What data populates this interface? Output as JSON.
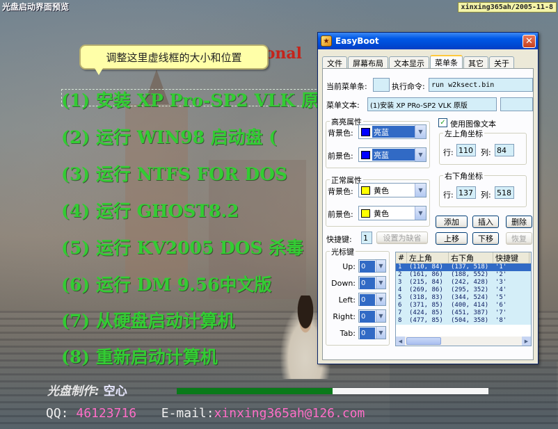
{
  "preview": {
    "title": "光盘启动界面预览",
    "author_stamp": "xinxing365ah/2005-11-8",
    "hint": "调整这里虚线框的大小和位置",
    "banner_fragment": "sional",
    "menu_items": [
      "(1) 安装 XP Pro-SP2 VLK 原",
      "(2) 运行 WIN98 启动盘 (",
      "(3) 运行 NTFS FOR DOS",
      "(4) 运行 GHOST8.2",
      "(5) 运行 KV2005 DOS 杀毒",
      "(6) 运行 DM 9.56中文版",
      "(7) 从硬盘启动计算机",
      "(8) 重新启动计算机"
    ],
    "credits_label": "光盘制作:",
    "credits_name": "空心",
    "progress_fraction": 0.5,
    "qq_label": "QQ:",
    "qq_value": "46123716",
    "email_label": "E-mail:",
    "email_value": "xinxing365ah@126.com"
  },
  "dialog": {
    "title": "EasyBoot",
    "tabs": [
      "文件",
      "屏幕布局",
      "文本显示",
      "菜单条",
      "其它",
      "关于"
    ],
    "active_tab": "菜单条",
    "current_menu_label": "当前菜单条:",
    "current_menu_value": "",
    "exec_label": "执行命令:",
    "exec_value": "run w2ksect.bin",
    "menu_text_label": "菜单文本:",
    "menu_text_value": "(1)安装 XP PRo-SP2 VLK 原版",
    "highlight_group": "高亮属性",
    "bg_color_label": "背景色:",
    "fg_color_label": "前景色:",
    "highlight_bg": {
      "name": "亮蓝",
      "color": "#0000ff"
    },
    "highlight_fg": {
      "name": "亮蓝",
      "color": "#0000ff"
    },
    "normal_group": "正常属性",
    "normal_bg": {
      "name": "黄色",
      "color": "#ffff00"
    },
    "normal_fg": {
      "name": "黄色",
      "color": "#ffff00"
    },
    "use_image_text": "使用图像文本",
    "use_image_checked": true,
    "top_left_group": "左上角坐标",
    "bottom_right_group": "右下角坐标",
    "row_label": "行:",
    "col_label": "列:",
    "top_left_row": "110",
    "top_left_col": "84",
    "bottom_right_row": "137",
    "bottom_right_col": "518",
    "buttons": {
      "add": "添加",
      "insert": "插入",
      "delete": "删除",
      "up": "上移",
      "down": "下移",
      "restore": "恢复"
    },
    "hotkey_label": "快捷键:",
    "hotkey_value": "1",
    "set_default": "设置为缺省",
    "cursor_group": "光标键",
    "cursor_keys": [
      {
        "label": "Up:",
        "value": "0"
      },
      {
        "label": "Down:",
        "value": "0"
      },
      {
        "label": "Left:",
        "value": "0"
      },
      {
        "label": "Right:",
        "value": "0"
      },
      {
        "label": "Tab:",
        "value": "0"
      }
    ],
    "table": {
      "headers": [
        "#",
        "左上角",
        "右下角",
        "快捷键"
      ],
      "rows": [
        [
          "1",
          "(110, 84)",
          "(137, 518)",
          "'1'"
        ],
        [
          "2",
          "(161, 86)",
          "(188, 552)",
          "'2'"
        ],
        [
          "3",
          "(215, 84)",
          "(242, 428)",
          "'3'"
        ],
        [
          "4",
          "(269, 86)",
          "(295, 352)",
          "'4'"
        ],
        [
          "5",
          "(318, 83)",
          "(344, 524)",
          "'5'"
        ],
        [
          "6",
          "(371, 85)",
          "(400, 414)",
          "'6'"
        ],
        [
          "7",
          "(424, 85)",
          "(451, 387)",
          "'7'"
        ],
        [
          "8",
          "(477, 85)",
          "(504, 358)",
          "'8'"
        ]
      ]
    }
  }
}
